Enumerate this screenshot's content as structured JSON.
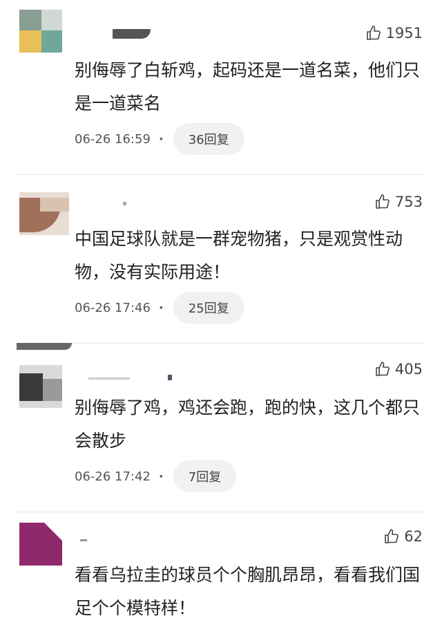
{
  "comments": [
    {
      "likes": "1951",
      "text": "别侮辱了白斩鸡，起码还是一道名菜，他们只是一道菜名",
      "time": "06-26 16:59",
      "reply": "36回复",
      "avatar_colors": [
        "#8a9e93",
        "#e8c05a",
        "#6fa89b"
      ]
    },
    {
      "likes": "753",
      "text": "中国足球队就是一群宠物猪，只是观赏性动物，没有实际用途！",
      "time": "06-26 17:46",
      "reply": "25回复",
      "avatar_colors": [
        "#a0705a",
        "#d9c2b0",
        "#5a3a2c"
      ]
    },
    {
      "likes": "405",
      "text": "别侮辱了鸡，鸡还会跑，跑的快，这几个都只会散步",
      "time": "06-26 17:42",
      "reply": "7回复",
      "avatar_colors": [
        "#3a3a3a",
        "#9a9a9a",
        "#6b6b6b"
      ]
    },
    {
      "likes": "62",
      "text": "看看乌拉圭的球员个个胸肌昂昂，看看我们国足个个模特样！",
      "avatar_colors": [
        "#8e2a6b",
        "#b14a8a",
        "#6c1f52"
      ]
    }
  ]
}
